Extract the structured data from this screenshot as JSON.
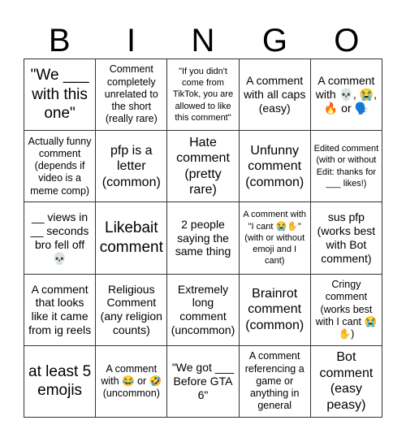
{
  "header": {
    "letters": [
      "B",
      "I",
      "N",
      "G",
      "O"
    ]
  },
  "grid": {
    "rows": [
      [
        {
          "text": "\"We ___ with this one\"",
          "size": "xl"
        },
        {
          "text": "Comment completely unrelated to the short (really rare)",
          "size": "s"
        },
        {
          "text": "\"If you didn't come from TikTok, you are allowed to like this comment\"",
          "size": "xs"
        },
        {
          "text": "A comment with all caps (easy)",
          "size": "m"
        },
        {
          "text": "A comment with 💀, 😭, 🔥 or 🗣️",
          "size": "m"
        }
      ],
      [
        {
          "text": "Actually funny comment (depends if video is a meme comp)",
          "size": "s"
        },
        {
          "text": "pfp is a letter (common)",
          "size": "l"
        },
        {
          "text": "Hate comment (pretty rare)",
          "size": "l"
        },
        {
          "text": "Unfunny comment (common)",
          "size": "l"
        },
        {
          "text": "Edited comment (with or without Edit: thanks for ___ likes!)",
          "size": "xs"
        }
      ],
      [
        {
          "text": "__ views in __ seconds bro fell off 💀",
          "size": "m"
        },
        {
          "text": "Likebait comment",
          "size": "xl"
        },
        {
          "text": "2 people saying the same thing",
          "size": "m"
        },
        {
          "text": "A comment with \"I cant 😭✋\" (with or without emoji and I cant)",
          "size": "xs"
        },
        {
          "text": "sus pfp (works best with Bot comment)",
          "size": "m"
        }
      ],
      [
        {
          "text": "A comment that looks like it came from ig reels",
          "size": "m"
        },
        {
          "text": "Religious Comment (any religion counts)",
          "size": "m"
        },
        {
          "text": "Extremely long comment (uncommon)",
          "size": "m"
        },
        {
          "text": "Brainrot comment (common)",
          "size": "l"
        },
        {
          "text": "Cringy comment (works best with I cant 😭✋)",
          "size": "s"
        }
      ],
      [
        {
          "text": "at least 5 emojis",
          "size": "xl"
        },
        {
          "text": "A comment with 😂 or 🤣 (uncommon)",
          "size": "s"
        },
        {
          "text": "\"We got ___ Before GTA 6\"",
          "size": "m"
        },
        {
          "text": "A comment referencing a game or anything in general",
          "size": "s"
        },
        {
          "text": "Bot comment (easy peasy)",
          "size": "l"
        }
      ]
    ]
  }
}
